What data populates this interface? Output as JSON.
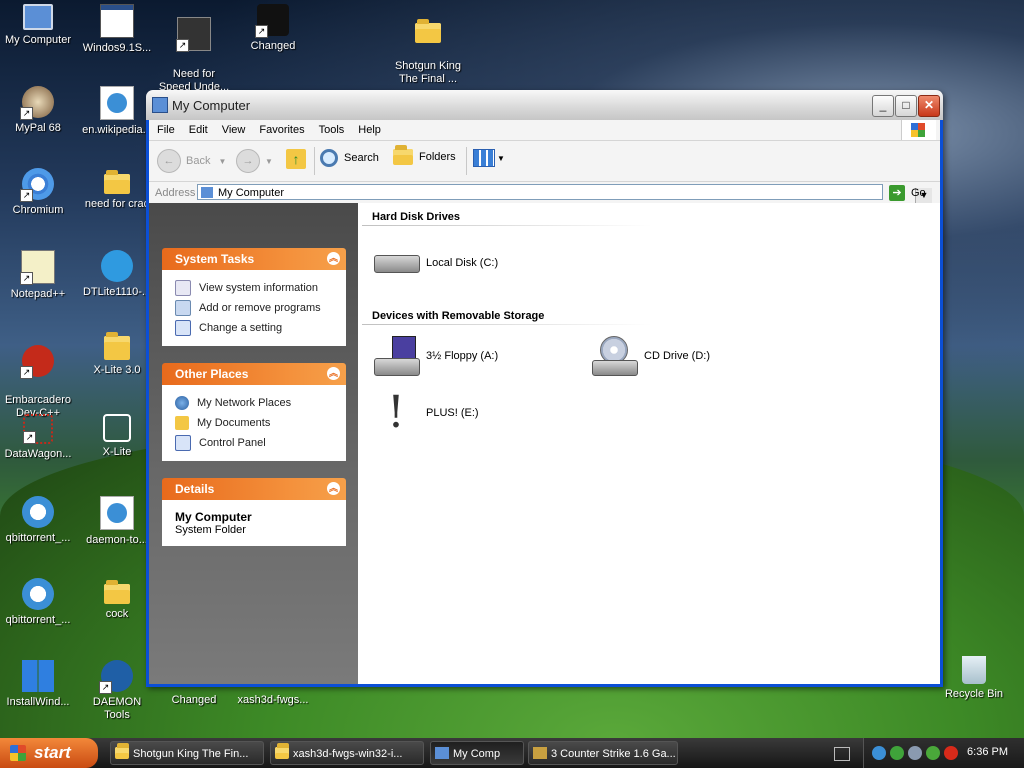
{
  "desktop": {
    "icons": [
      {
        "label": "My Computer",
        "icon": "my-computer-icon"
      },
      {
        "label": "Windos9.1S...",
        "icon": "window-icon"
      },
      {
        "label": "Need for\nSpeed Unde...",
        "icon": "nfs-icon"
      },
      {
        "label": "Changed",
        "icon": "cat-icon"
      },
      {
        "label": "Shotgun King\nThe Final ...",
        "icon": "folder-icon"
      },
      {
        "label": "MyPal 68",
        "icon": "mypal-icon"
      },
      {
        "label": "en.wikipedia...",
        "icon": "qb-icon"
      },
      {
        "label": "Chromium",
        "icon": "chromium-icon"
      },
      {
        "label": "need for crac",
        "icon": "folder-icon"
      },
      {
        "label": "Notepad++",
        "icon": "notepad-icon"
      },
      {
        "label": "DTLite1110-...",
        "icon": "daemon-icon"
      },
      {
        "label": "Embarcadero\nDev-C++",
        "icon": "devcpp-icon"
      },
      {
        "label": "X-Lite 3.0",
        "icon": "zip-icon"
      },
      {
        "label": "DataWagon...",
        "icon": "datawagon-icon"
      },
      {
        "label": "X-Lite",
        "icon": "xlite-icon"
      },
      {
        "label": "qbittorrent_...",
        "icon": "installer-icon"
      },
      {
        "label": "daemon-to...",
        "icon": "qb-icon"
      },
      {
        "label": "qbittorrent_...",
        "icon": "installer-icon"
      },
      {
        "label": "cock",
        "icon": "folder-icon"
      },
      {
        "label": "InstallWind...",
        "icon": "windows-icon"
      },
      {
        "label": "DAEMON Tools",
        "icon": "daemon-icon"
      },
      {
        "label": "Changed",
        "icon": "none"
      },
      {
        "label": "xash3d-fwgs...",
        "icon": "none"
      },
      {
        "label": "Recycle Bin",
        "icon": "recycle-bin-icon"
      }
    ]
  },
  "window": {
    "title": "My Computer",
    "menu": [
      "File",
      "Edit",
      "View",
      "Favorites",
      "Tools",
      "Help"
    ],
    "toolbar": {
      "back": "Back",
      "search": "Search",
      "folders": "Folders"
    },
    "address": {
      "label": "Address",
      "value": "My Computer",
      "go": "Go"
    },
    "system_tasks": {
      "title": "System Tasks",
      "items": [
        "View system information",
        "Add or remove programs",
        "Change a setting"
      ]
    },
    "other_places": {
      "title": "Other Places",
      "items": [
        "My Network Places",
        "My Documents",
        "Control Panel"
      ]
    },
    "details": {
      "title": "Details",
      "name": "My Computer",
      "type": "System Folder"
    },
    "groups": {
      "hard_disk": "Hard Disk Drives",
      "removable": "Devices with Removable Storage"
    },
    "drives": {
      "c": "Local Disk (C:)",
      "a": "3½ Floppy (A:)",
      "d": "CD Drive (D:)",
      "e": "PLUS! (E:)"
    }
  },
  "taskbar": {
    "start": "start",
    "tasks": [
      "Shotgun King The Fin...",
      "xash3d-fwgs-win32-i...",
      "My Comp",
      "3 Counter Strike 1.6 Ga..."
    ],
    "clock": "6:36 PM"
  }
}
